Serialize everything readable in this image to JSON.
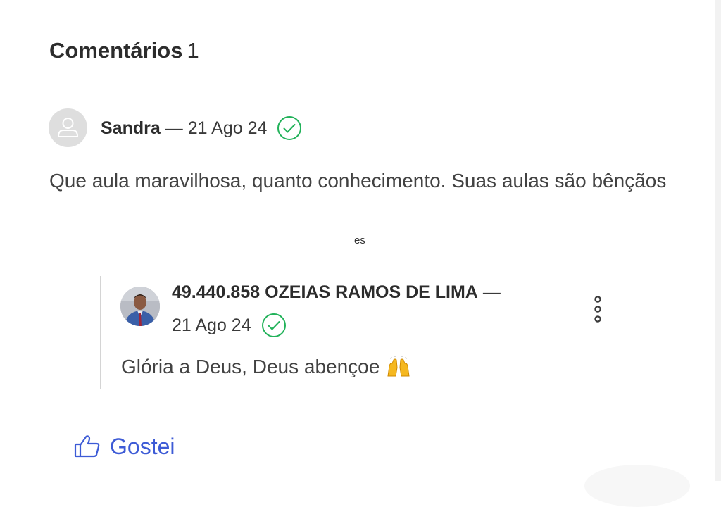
{
  "comments_section": {
    "title": "Comentários",
    "count": "1"
  },
  "comment": {
    "author": "Sandra",
    "separator": "—",
    "date": "21 Ago 24",
    "text": "Que aula maravilhosa, quanto conhecimento. Suas aulas são bênçãos",
    "avatar_icon": "user-placeholder-icon",
    "verified_icon": "check-circle-icon"
  },
  "stray_text": "es",
  "reply": {
    "author": "49.440.858 OZEIAS RAMOS DE LIMA",
    "separator": "—",
    "date": "21 Ago 24",
    "text": "Glória a Deus, Deus abençoe",
    "emoji_icon": "raising-hands-icon",
    "menu_icon": "vertical-ellipsis-icon",
    "verified_icon": "check-circle-icon"
  },
  "actions": {
    "like_label": "Gostei",
    "like_icon": "thumbs-up-icon"
  },
  "colors": {
    "accent_blue": "#3d5bd6",
    "verified_green": "#22b25a",
    "text_dark": "#2c2c2c",
    "text_body": "#424242"
  }
}
